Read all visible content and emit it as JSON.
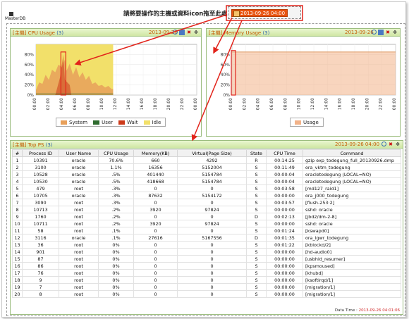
{
  "drop_area": {
    "instruction": "請將要操作的主機或資料icon拖至此處",
    "chip_label": "2013-09-26 04:00"
  },
  "host": {
    "name": "MasterDB"
  },
  "cpu_panel": {
    "title": "[主機] CPU Usage",
    "badge": "(3)",
    "date": "2013-09-26"
  },
  "memory_panel": {
    "title": "[主機] Memory Usage",
    "badge": "(3)",
    "date": "2013-09-26"
  },
  "chart_data": [
    {
      "type": "area",
      "title": "",
      "x": [
        "00:00",
        "02:00",
        "04:00",
        "06:00",
        "08:00",
        "10:00",
        "12:00",
        "14:00",
        "16:00",
        "18:00",
        "20:00",
        "22:00",
        "00:00"
      ],
      "ylim": [
        0,
        100
      ],
      "yticks": [
        "0%",
        "20%",
        "40%",
        "60%",
        "80%"
      ],
      "series": [
        {
          "name": "System",
          "color": "#e8a05a"
        },
        {
          "name": "User",
          "color": "#2e6b2e"
        },
        {
          "name": "Wait",
          "color": "#cc3a1a"
        },
        {
          "name": "Idle",
          "color": "#f2e06a"
        }
      ],
      "legend": "bottom",
      "grid": true
    },
    {
      "type": "area",
      "title": "",
      "x": [
        "00:00",
        "02:00",
        "04:00",
        "06:00",
        "08:00",
        "10:00",
        "12:00",
        "14:00",
        "16:00",
        "18:00",
        "20:00",
        "22:00",
        "00:00"
      ],
      "ylim": [
        0,
        100
      ],
      "yticks": [
        "0%",
        "20%",
        "40%",
        "60%",
        "80%"
      ],
      "series": [
        {
          "name": "Usage",
          "color": "#f2b288",
          "values_percent_flat": 85
        }
      ],
      "legend": "bottom",
      "grid": true
    }
  ],
  "ps_panel": {
    "title": "[主機] Top PS",
    "badge": "(3)",
    "date": "2013-09-26 04:00",
    "columns": [
      "#",
      "Process ID",
      "User Name",
      "CPU Usage",
      "Memory(KB)",
      "Virtual(Page Size)",
      "State",
      "CPU Time",
      "Command"
    ],
    "rows": [
      [
        "1",
        "10391",
        "oracle",
        "70.6%",
        "660",
        "4292",
        "R",
        "00:14:25",
        "gzip exp_todegung_full_20130926.dmp"
      ],
      [
        "2",
        "3100",
        "oracle",
        "1.1%",
        "16356",
        "5152004",
        "S",
        "00:11:49",
        "ora_vktm_todegung"
      ],
      [
        "3",
        "10528",
        "oracle",
        ".5%",
        "401440",
        "5154784",
        "S",
        "00:00:04",
        "oracletodegung (LOCAL=NO)"
      ],
      [
        "4",
        "10530",
        "oracle",
        ".5%",
        "418668",
        "5154784",
        "S",
        "00:00:04",
        "oracletodegung (LOCAL=NO)"
      ],
      [
        "5",
        "479",
        "root",
        ".3%",
        "0",
        "0",
        "S",
        "00:03:58",
        "[md127_raid1]"
      ],
      [
        "6",
        "10705",
        "oracle",
        ".3%",
        "87632",
        "5154172",
        "S",
        "00:00:00",
        "ora_j000_todegung"
      ],
      [
        "7",
        "3090",
        "root",
        ".3%",
        "0",
        "0",
        "S",
        "00:03:57",
        "[flush-253:2]"
      ],
      [
        "8",
        "10713",
        "root",
        ".2%",
        "3920",
        "97824",
        "S",
        "00:00:00",
        "sshd: oracle"
      ],
      [
        "9",
        "1760",
        "root",
        ".2%",
        "0",
        "0",
        "D",
        "00:02:13",
        "[jbd2/dm-2-8]"
      ],
      [
        "10",
        "10711",
        "root",
        ".2%",
        "3920",
        "97824",
        "S",
        "00:00:00",
        "sshd: oracle"
      ],
      [
        "11",
        "58",
        "root",
        ".1%",
        "0",
        "0",
        "S",
        "00:01:24",
        "[kswapd0]"
      ],
      [
        "12",
        "3116",
        "oracle",
        ".1%",
        "27616",
        "5167556",
        "D",
        "00:01:35",
        "ora_lgwr_todegung"
      ],
      [
        "13",
        "36",
        "root",
        "0%",
        "0",
        "0",
        "S",
        "00:01:22",
        "[kblockd/2]"
      ],
      [
        "14",
        "901",
        "root",
        "0%",
        "0",
        "0",
        "S",
        "00:00:00",
        "[hd-audio0]"
      ],
      [
        "15",
        "87",
        "root",
        "0%",
        "0",
        "0",
        "S",
        "00:00:00",
        "[usbhid_resumer]"
      ],
      [
        "16",
        "86",
        "root",
        "0%",
        "0",
        "0",
        "S",
        "00:00:00",
        "[kpsmoused]"
      ],
      [
        "17",
        "76",
        "root",
        "0%",
        "0",
        "0",
        "S",
        "00:00:00",
        "[khubd]"
      ],
      [
        "18",
        "9",
        "root",
        "0%",
        "0",
        "0",
        "S",
        "00:00:00",
        "[ksoftirqd/1]"
      ],
      [
        "19",
        "7",
        "root",
        "0%",
        "0",
        "0",
        "S",
        "00:00:00",
        "[migration/1]"
      ],
      [
        "20",
        "8",
        "root",
        "0%",
        "0",
        "0",
        "S",
        "00:00:00",
        "[migration/1]"
      ]
    ],
    "footer_label": "Data Time :",
    "footer_value": "2013-09-26 04:01:06"
  },
  "colors": {
    "annotation_red": "#e2231a",
    "panel_header": "#cfe6a4",
    "accent_orange": "#c55a00"
  }
}
